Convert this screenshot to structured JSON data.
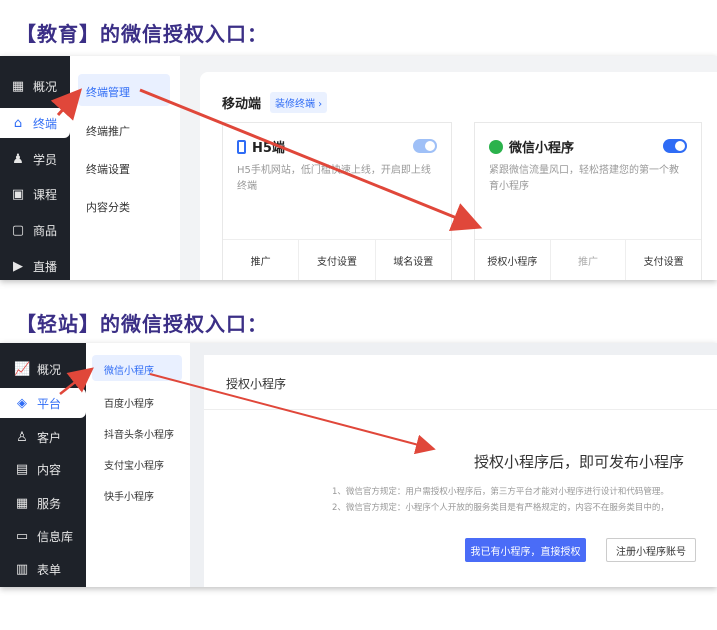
{
  "headings": {
    "edu": "【教育】的微信授权入口：",
    "qingzhan": "【轻站】的微信授权入口："
  },
  "shot1": {
    "nav": [
      {
        "icon": "▦",
        "label": "概况",
        "active": false
      },
      {
        "icon": "⌂",
        "label": "终端",
        "active": true
      },
      {
        "icon": "♟",
        "label": "学员",
        "active": false
      },
      {
        "icon": "▣",
        "label": "课程",
        "active": false
      },
      {
        "icon": "▢",
        "label": "商品",
        "active": false
      },
      {
        "icon": "▶",
        "label": "直播",
        "active": false
      }
    ],
    "subnav": [
      "终端管理",
      "终端推广",
      "终端设置",
      "内容分类"
    ],
    "section_title": "移动端",
    "decorate_tag": "装修终端 ›",
    "cards": {
      "h5": {
        "title": "H5端",
        "desc_line1": "H5手机网站，低门槛快速上线，开启即上线",
        "desc_line2": "终端",
        "actions": [
          "推广",
          "支付设置",
          "域名设置"
        ]
      },
      "mini": {
        "title": "微信小程序",
        "desc_line1": "紧跟微信流量风口，轻松搭建您的第一个教",
        "desc_line2": "育小程序",
        "actions": [
          "授权小程序",
          "推广",
          "支付设置"
        ]
      }
    },
    "colors": {
      "toggle_off": "#9fc0f7",
      "toggle_on": "#2f6cf5",
      "arrow": "#e0473a"
    }
  },
  "shot2": {
    "nav": [
      {
        "icon": "📈",
        "label": "概况",
        "active": false
      },
      {
        "icon": "◈",
        "label": "平台",
        "active": true
      },
      {
        "icon": "♙",
        "label": "客户",
        "active": false
      },
      {
        "icon": "▤",
        "label": "内容",
        "active": false
      },
      {
        "icon": "▦",
        "label": "服务",
        "active": false
      },
      {
        "icon": "▭",
        "label": "信息库",
        "active": false
      },
      {
        "icon": "▥",
        "label": "表单",
        "active": false
      }
    ],
    "subnav": [
      "微信小程序",
      "百度小程序",
      "抖音头条小程序",
      "支付宝小程序",
      "快手小程序"
    ],
    "panel_title": "授权小程序",
    "headline": "授权小程序后，即可发布小程序",
    "rule1": "1、微信官方规定：用户需授权小程序后，第三方平台才能对小程序进行设计和代码管理。",
    "rule2": "2、微信官方规定：小程序个人开放的服务类目是有严格规定的，内容不在服务类目中的，",
    "btn_primary": "我已有小程序，直接授权",
    "btn_secondary": "注册小程序账号",
    "colors": {
      "primary": "#4a6cf7"
    }
  }
}
